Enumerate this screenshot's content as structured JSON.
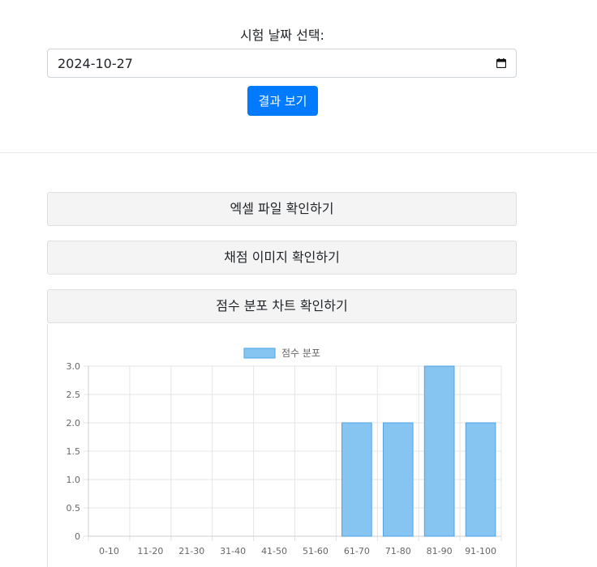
{
  "form": {
    "date_label": "시험 날짜 선택:",
    "date_value": "2024-10-27",
    "calendar_icon": "calendar-icon",
    "submit_label": "결과 보기",
    "submit_color": "#007bff"
  },
  "panels": {
    "excel": "엑셀 파일 확인하기",
    "grading": "채점 이미지 확인하기",
    "chart": "점수 분포 차트 확인하기"
  },
  "chart_data": {
    "type": "bar",
    "categories": [
      "0-10",
      "11-20",
      "21-30",
      "31-40",
      "41-50",
      "51-60",
      "61-70",
      "71-80",
      "81-90",
      "91-100"
    ],
    "series": [
      {
        "name": "점수 분포",
        "values": [
          0,
          0,
          0,
          0,
          0,
          0,
          2,
          2,
          3,
          2
        ]
      }
    ],
    "ylim": [
      0,
      3
    ],
    "yticks": [
      "0",
      "0.5",
      "1.0",
      "1.5",
      "2.0",
      "2.5",
      "3.0"
    ],
    "grid": true,
    "legend": "top",
    "bar_fill": "#86c5f1",
    "bar_stroke": "#4fa3e6"
  }
}
